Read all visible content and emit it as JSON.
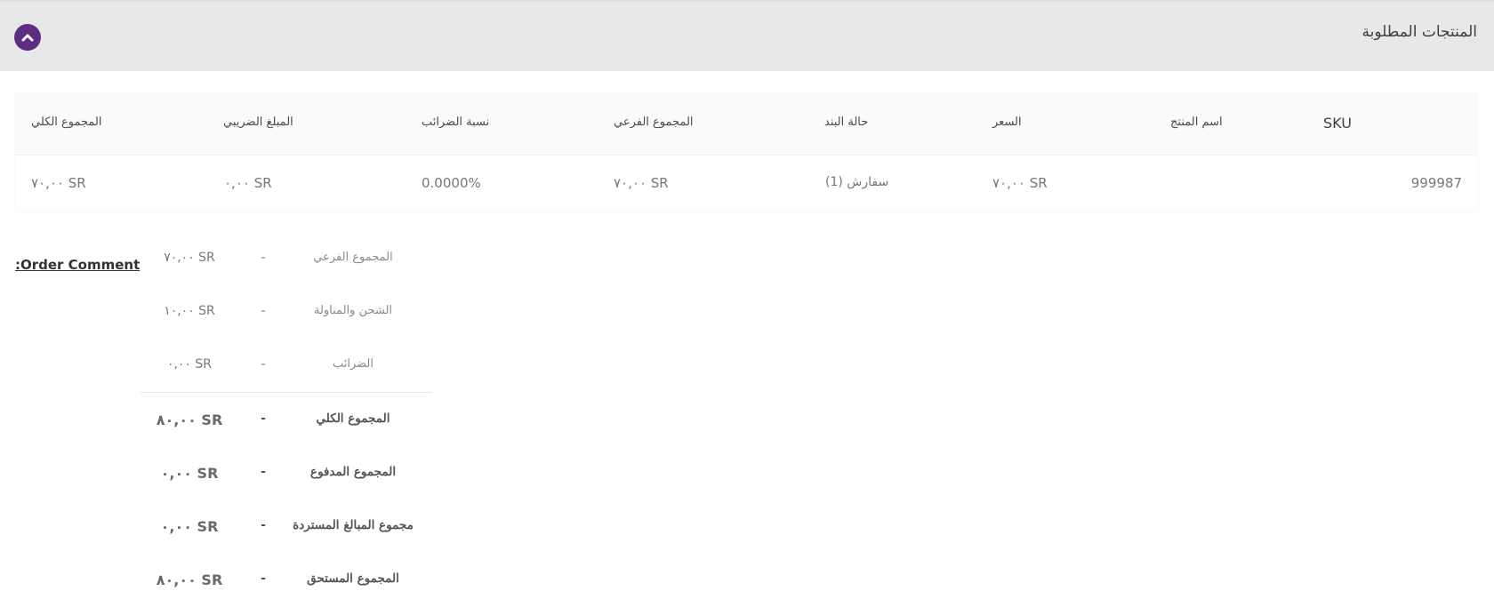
{
  "section": {
    "title": "المنتجات المطلوبة",
    "collapse_icon": "chevron-up-icon",
    "accent_color": "#5d2d83"
  },
  "table": {
    "headers": {
      "sku": "SKU",
      "product_name": "اسم المنتج",
      "price": "السعر",
      "item_status": "حالة البند",
      "subtotal": "المجموع الفرعي",
      "tax_percent": "نسبة الضرائب",
      "tax_amount": "المبلغ الضريبي",
      "row_total": "المجموع الكلي"
    },
    "rows": [
      {
        "sku": "999987",
        "product_name": "",
        "price": "٧٠,٠٠ SR",
        "item_status": "(1) سفارش",
        "subtotal": "٧٠,٠٠ SR",
        "tax_percent": "0.0000%",
        "tax_amount": "٠,٠٠ SR",
        "row_total": "٧٠,٠٠ SR"
      }
    ]
  },
  "order_comment": {
    "label": ":Order Comment"
  },
  "totals": {
    "rows": [
      {
        "label": "المجموع الفرعي",
        "separator": "-",
        "value": "٧٠,٠٠ SR"
      },
      {
        "label": "الشحن والمناولة",
        "separator": "-",
        "value": "١٠,٠٠ SR"
      },
      {
        "label": "الضرائب",
        "separator": "-",
        "value": "٠,٠٠ SR"
      },
      {
        "label": "المجموع الكلي",
        "separator": "-",
        "value": "٨٠,٠٠ SR"
      },
      {
        "label": "المجموع المدفوع",
        "separator": "-",
        "value": "٠,٠٠ SR"
      },
      {
        "label": "مجموع المبالغ المستردة",
        "separator": "-",
        "value": "٠,٠٠ SR"
      },
      {
        "label": "المجموع المستحق",
        "separator": "-",
        "value": "٨٠,٠٠ SR"
      }
    ]
  }
}
